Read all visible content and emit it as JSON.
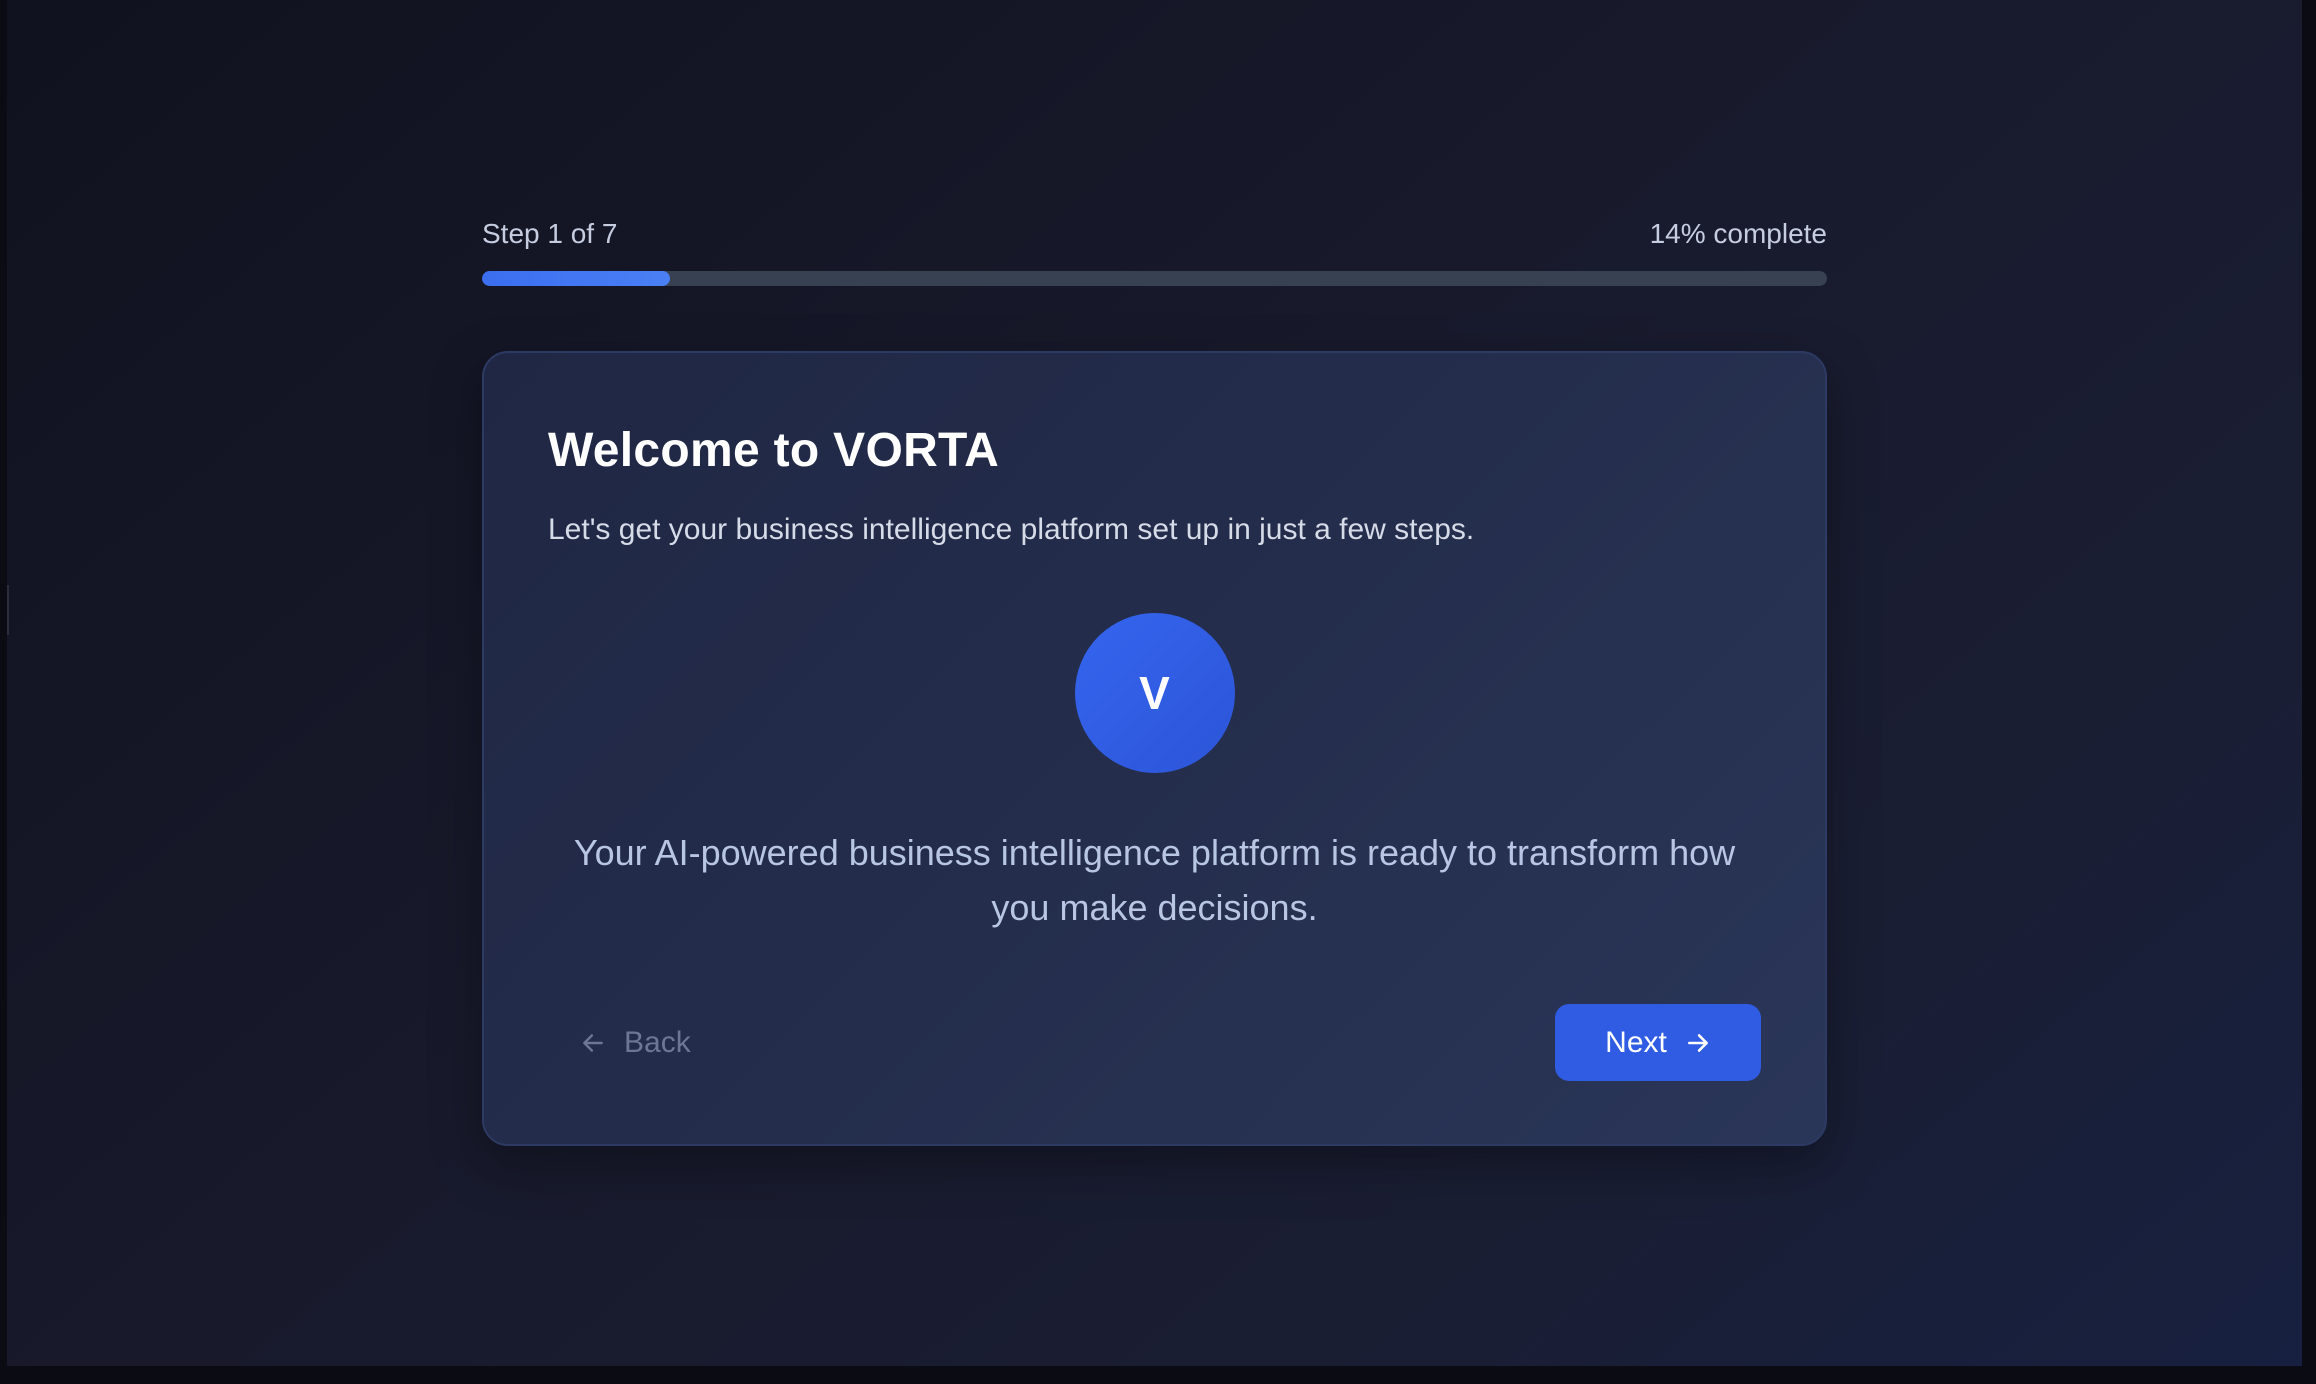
{
  "progress": {
    "step_label": "Step 1 of 7",
    "percent_label": "14% complete",
    "fraction": 0.14
  },
  "card": {
    "title": "Welcome to VORTA",
    "subtitle": "Let's get your business intelligence platform set up in just a few steps.",
    "logo_letter": "V",
    "description": "Your AI-powered business intelligence platform is ready to transform how you make decisions."
  },
  "footer": {
    "back_label": "Back",
    "back_icon": "arrow-left-icon",
    "next_label": "Next",
    "next_icon": "arrow-right-icon"
  },
  "colors": {
    "accent": "#2f5ce3",
    "progress_fill": "#3b6ef0",
    "progress_track": "#374152",
    "card_background": "#242d4c",
    "page_background": "#181a2c"
  }
}
